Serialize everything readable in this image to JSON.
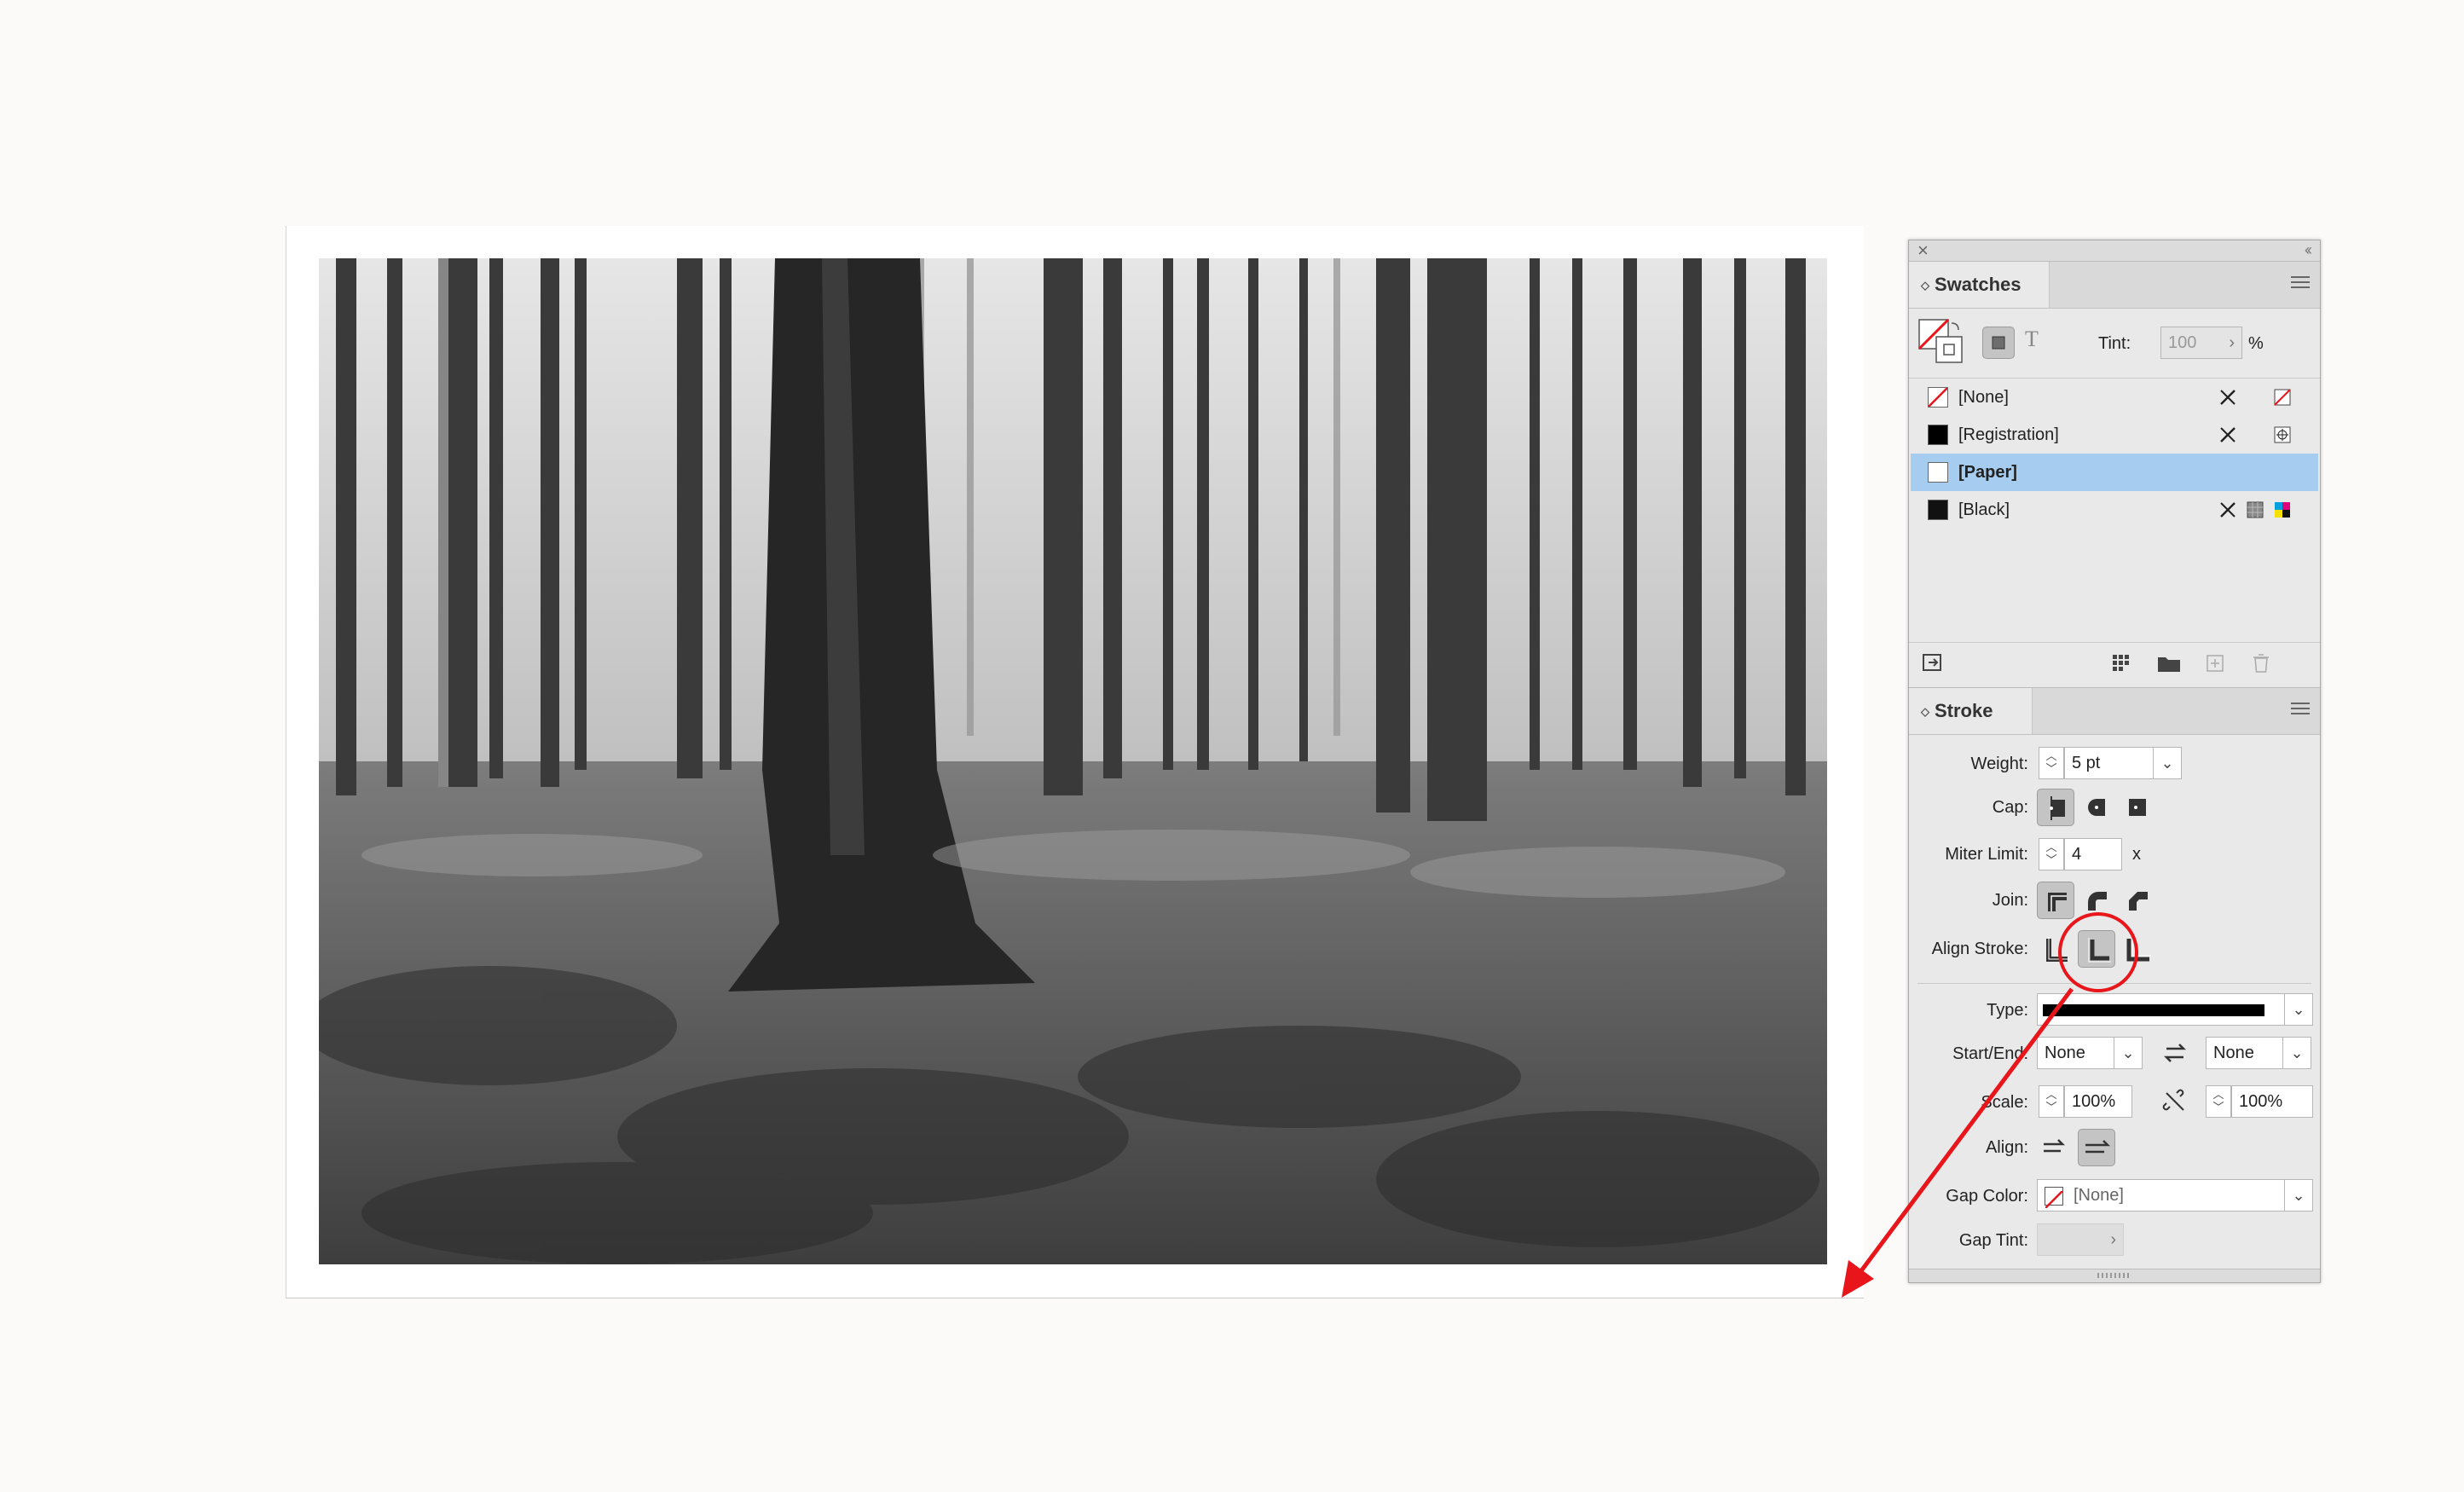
{
  "swatches_panel": {
    "tab_label": "Swatches",
    "tint_label": "Tint:",
    "tint_value": "100",
    "percent": "%",
    "items": [
      {
        "name": "[None]",
        "selected": false
      },
      {
        "name": "[Registration]",
        "selected": false
      },
      {
        "name": "[Paper]",
        "selected": true
      },
      {
        "name": "[Black]",
        "selected": false
      }
    ]
  },
  "stroke_panel": {
    "tab_label": "Stroke",
    "weight_label": "Weight:",
    "weight_value": "5 pt",
    "cap_label": "Cap:",
    "miter_label": "Miter Limit:",
    "miter_value": "4",
    "miter_unit": "x",
    "join_label": "Join:",
    "align_stroke_label": "Align Stroke:",
    "type_label": "Type:",
    "start_end_label": "Start/End:",
    "start_value": "None",
    "end_value": "None",
    "scale_label": "Scale:",
    "scale_start": "100%",
    "scale_end": "100%",
    "align_label": "Align:",
    "gap_color_label": "Gap Color:",
    "gap_color_value": "[None]",
    "gap_tint_label": "Gap Tint:"
  },
  "colors": {
    "selection": "#a6cdf0",
    "annotation": "#e8151b"
  }
}
